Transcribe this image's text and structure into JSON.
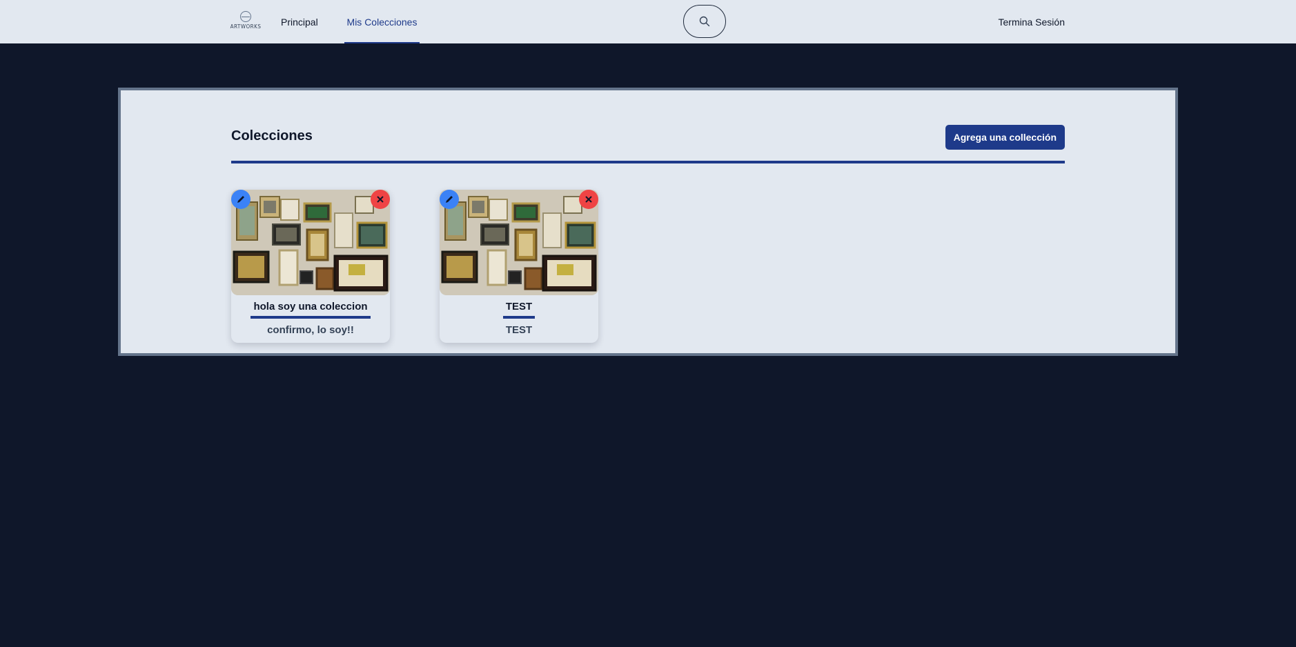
{
  "nav": {
    "logo_text": "ARTWORKS",
    "links": [
      "Principal",
      "Mis Colecciones"
    ],
    "logout": "Termina Sesión",
    "search_icon": "search-icon"
  },
  "main": {
    "title": "Colecciones",
    "add_button": "Agrega una collección",
    "collections": [
      {
        "title": "hola soy una coleccion",
        "description": "confirmo, lo soy!!"
      },
      {
        "title": "TEST",
        "description": "TEST"
      }
    ]
  },
  "colors": {
    "background": "#0f172a",
    "surface": "#e2e8f0",
    "accent": "#1e3a8a",
    "edit": "#3b82f6",
    "delete": "#ef4444"
  }
}
